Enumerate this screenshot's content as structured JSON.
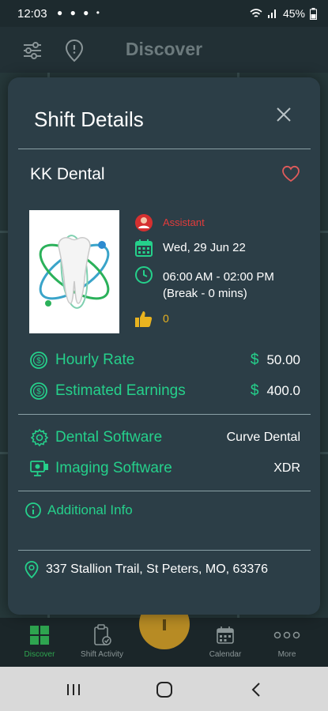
{
  "status_bar": {
    "time": "12:03",
    "battery": "45%"
  },
  "app_bar": {
    "title": "Discover",
    "filter_icon": "sliders-icon",
    "location_icon": "location-pin-icon"
  },
  "modal": {
    "title": "Shift Details",
    "clinic_name": "KK Dental",
    "role": "Assistant",
    "date": "Wed, 29 Jun 22",
    "time_range": "06:00 AM - 02:00 PM",
    "break_info": "(Break - 0 mins)",
    "likes": "0",
    "hourly_rate_label": "Hourly Rate",
    "hourly_rate_currency": "$",
    "hourly_rate_value": "50.00",
    "earnings_label": "Estimated Earnings",
    "earnings_currency": "$",
    "earnings_value": "400.0",
    "dental_software_label": "Dental Software",
    "dental_software_value": "Curve Dental",
    "imaging_software_label": "Imaging Software",
    "imaging_software_value": "XDR",
    "additional_info_label": "Additional Info",
    "address": "337 Stallion Trail, St Peters, MO, 63376"
  },
  "bottom_nav": {
    "items": [
      {
        "label": "Discover",
        "icon": "grid-icon"
      },
      {
        "label": "Shift Activity",
        "icon": "clipboard-check-icon"
      },
      {
        "label": "Calendar",
        "icon": "calendar-icon"
      },
      {
        "label": "More",
        "icon": "more-dots-icon"
      }
    ]
  },
  "colors": {
    "accent_green": "#25d08b",
    "role_red": "#e23b3b",
    "like_yellow": "#e9b31f",
    "modal_bg": "#2c3e47"
  }
}
